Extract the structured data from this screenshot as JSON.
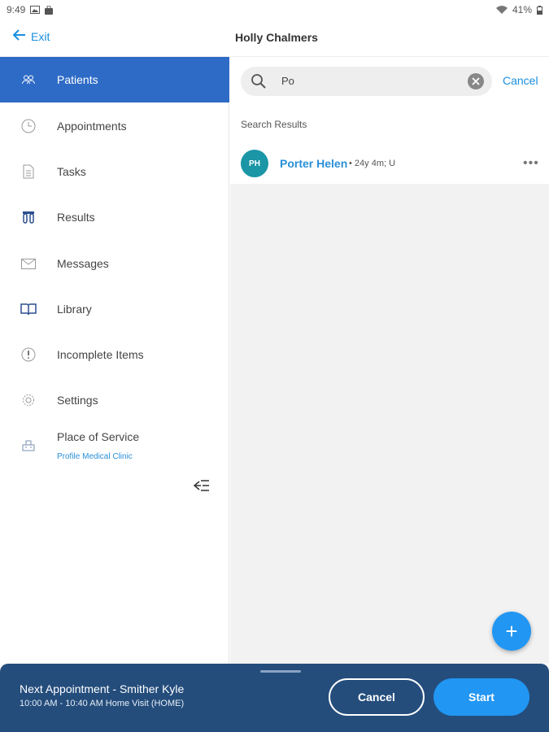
{
  "status_bar": {
    "time": "9:49",
    "battery": "41%",
    "icons": [
      "image-icon",
      "shopping-bag-icon",
      "wifi-icon",
      "battery-icon"
    ]
  },
  "header": {
    "exit_label": "Exit",
    "title": "Holly Chalmers"
  },
  "sidebar": {
    "items": [
      {
        "label": "Patients",
        "icon": "patients-icon",
        "active": true
      },
      {
        "label": "Appointments",
        "icon": "clock-icon"
      },
      {
        "label": "Tasks",
        "icon": "document-icon"
      },
      {
        "label": "Results",
        "icon": "test-tubes-icon"
      },
      {
        "label": "Messages",
        "icon": "envelope-icon"
      },
      {
        "label": "Library",
        "icon": "book-icon"
      },
      {
        "label": "Incomplete Items",
        "icon": "alert-icon"
      },
      {
        "label": "Settings",
        "icon": "gear-icon"
      },
      {
        "label": "Place of Service",
        "icon": "building-icon",
        "sublabel": "Profile Medical Clinic"
      }
    ]
  },
  "search": {
    "value": "Po",
    "cancel_label": "Cancel"
  },
  "results": {
    "header": "Search Results",
    "items": [
      {
        "initials": "PH",
        "name": "Porter Helen",
        "meta": "• 24y 4m; U"
      }
    ]
  },
  "fab_label": "+",
  "bottom_bar": {
    "title": "Next Appointment - Smither Kyle",
    "time": "10:00 AM - 10:40 AM  Home Visit (HOME)",
    "cancel_label": "Cancel",
    "start_label": "Start"
  },
  "colors": {
    "accent": "#2196f3",
    "active_nav": "#2e6bc6",
    "bottom_bar": "#244d7c",
    "avatar": "#1a96a6"
  }
}
